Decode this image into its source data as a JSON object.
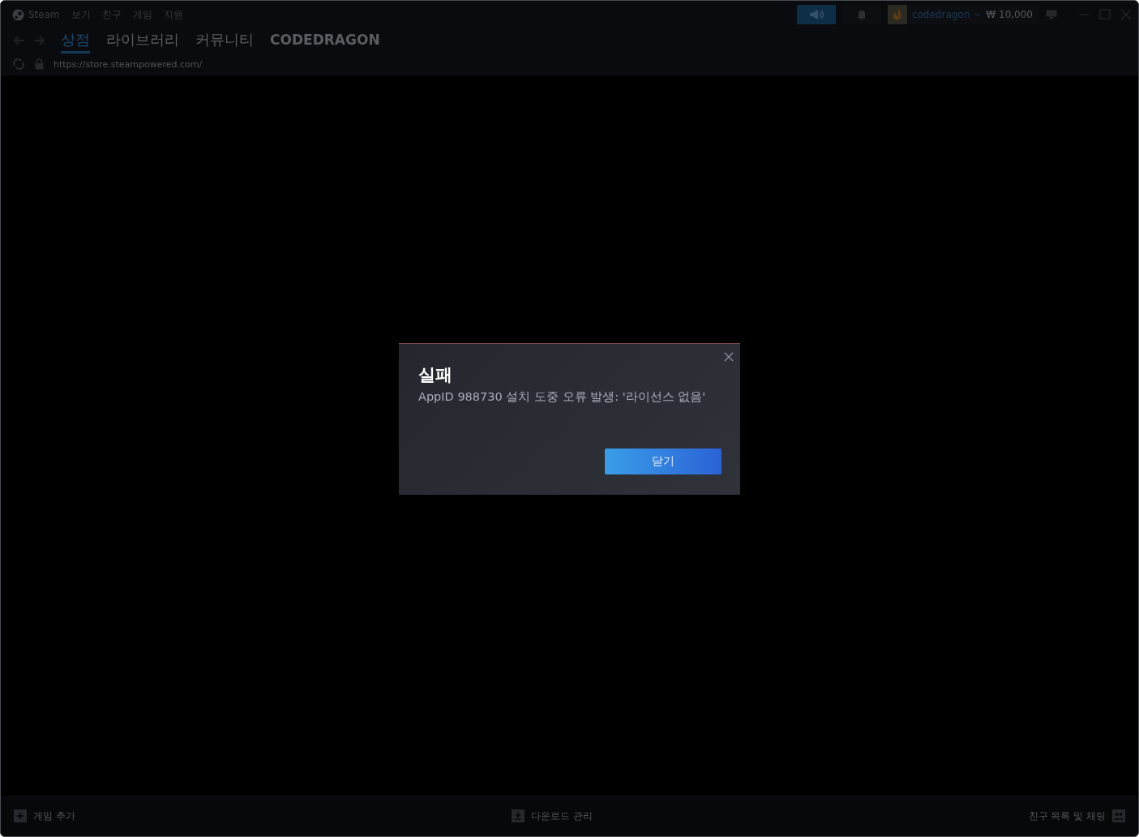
{
  "menu": [
    "Steam",
    "보기",
    "친구",
    "게임",
    "지원"
  ],
  "nav_tabs": [
    {
      "label": "상점",
      "selected": true
    },
    {
      "label": "라이브러리",
      "selected": false
    },
    {
      "label": "커뮤니티",
      "selected": false
    },
    {
      "label": "CODEDRAGON",
      "selected": false
    }
  ],
  "url": "https://store.steampowered.com/",
  "account": {
    "name": "codedragon",
    "balance": "₩ 10,000"
  },
  "footer": [
    "게임 추가",
    "다운로드 관리",
    "친구 목록 및 채팅"
  ],
  "dialog": {
    "title": "실패",
    "message": "AppID 988730 설치 도중 오류 발생: '라이선스 없음'",
    "button": "닫기"
  }
}
